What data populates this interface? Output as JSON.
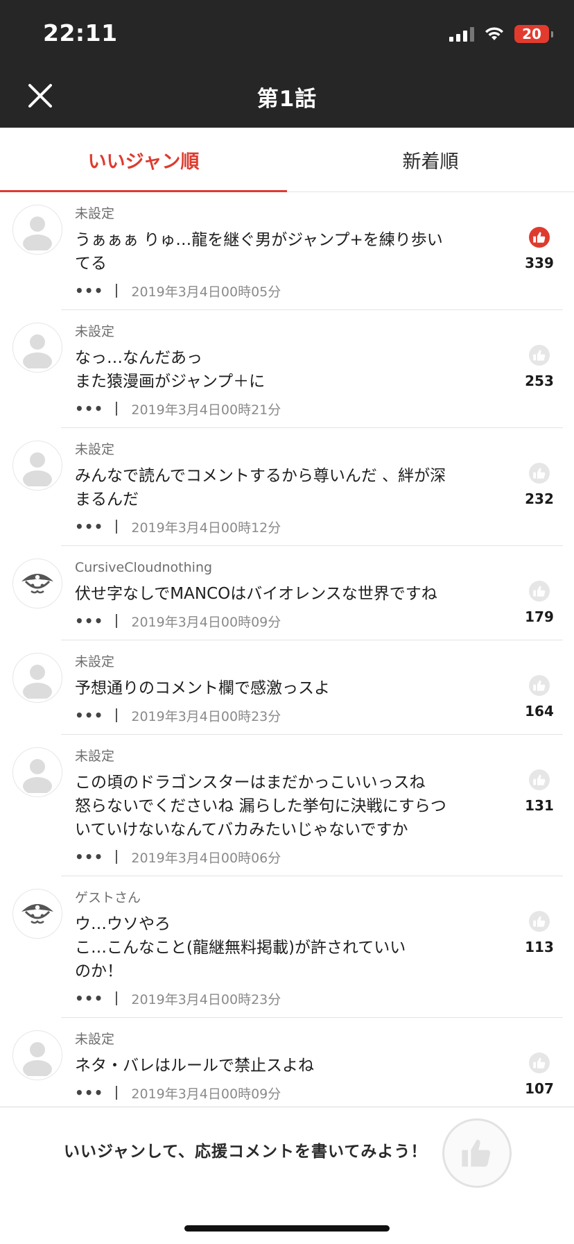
{
  "status": {
    "time": "22:11",
    "battery": "20"
  },
  "nav": {
    "title": "第1話"
  },
  "tabs": [
    {
      "label": "いいジャン順",
      "active": true
    },
    {
      "label": "新着順",
      "active": false
    }
  ],
  "comments": [
    {
      "user": "未設定",
      "avatar": "default",
      "text": "うぁぁぁ りゅ…龍を継ぐ男がジャンプ+を練り歩い\nてる",
      "date": "2019年3月4日00時05分",
      "likes": "339",
      "liked": true
    },
    {
      "user": "未設定",
      "avatar": "default",
      "text": "なっ…なんだあっ\nまた猿漫画がジャンプ＋に",
      "date": "2019年3月4日00時21分",
      "likes": "253",
      "liked": false
    },
    {
      "user": "未設定",
      "avatar": "default",
      "text": "みんなで読んでコメントするから尊いんだ 、絆が深\nまるんだ",
      "date": "2019年3月4日00時12分",
      "likes": "232",
      "liked": false
    },
    {
      "user": "CursiveCloudnothing",
      "avatar": "pirate",
      "text": "伏せ字なしでMANCOはバイオレンスな世界ですね",
      "date": "2019年3月4日00時09分",
      "likes": "179",
      "liked": false
    },
    {
      "user": "未設定",
      "avatar": "default",
      "text": "予想通りのコメント欄で感激っスよ",
      "date": "2019年3月4日00時23分",
      "likes": "164",
      "liked": false
    },
    {
      "user": "未設定",
      "avatar": "default",
      "text": "この頃のドラゴンスターはまだかっこいいっスね\n怒らないでくださいね 漏らした挙句に決戦にすらつ\nいていけないなんてバカみたいじゃないですか",
      "date": "2019年3月4日00時06分",
      "likes": "131",
      "liked": false
    },
    {
      "user": "ゲストさん",
      "avatar": "pirate",
      "text": "ウ…ウソやろ\nこ…こんなこと(龍継無料掲載)が許されていい\nのか！",
      "date": "2019年3月4日00時23分",
      "likes": "113",
      "liked": false
    },
    {
      "user": "未設定",
      "avatar": "default",
      "text": "ネタ・バレはルールで禁止スよね",
      "date": "2019年3月4日00時09分",
      "likes": "107",
      "liked": false
    }
  ],
  "bottom": {
    "prompt": "いいジャンして、応援コメントを書いてみよう！"
  },
  "colors": {
    "accent": "#de3b2f",
    "header": "#262626"
  }
}
